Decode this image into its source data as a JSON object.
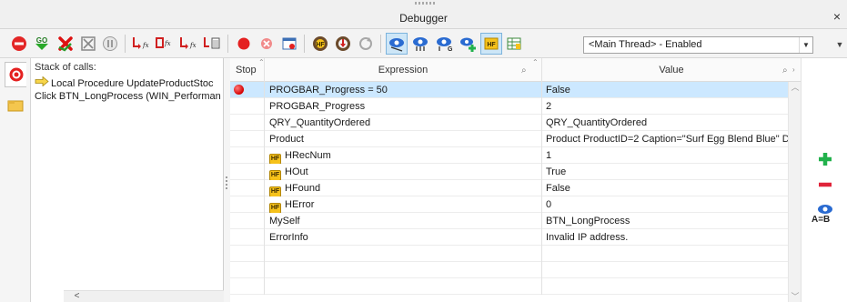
{
  "window": {
    "title": "Debugger",
    "close_glyph": "×"
  },
  "toolbar": {
    "icons": [
      "stop-circle-icon",
      "go-icon",
      "cancel-icon",
      "close-x-icon",
      "pause-icon",
      "step-into-icon",
      "step-over-icon",
      "step-out-icon",
      "run-to-cursor-icon",
      "breakpoint-icon",
      "clear-breakpoints-icon",
      "window-icon",
      "hf-trace-icon",
      "trace-icon",
      "refresh-icon",
      "watch-icon",
      "watch-all-icon",
      "watch-add-icon",
      "hf-toggle-icon",
      "table-toggle-icon"
    ],
    "thread": {
      "selected": "<Main Thread> - Enabled"
    }
  },
  "stack": {
    "title": "Stack of calls:",
    "rows": [
      "Local Procedure UpdateProductStoc",
      "Click BTN_LongProcess (WIN_Performan"
    ]
  },
  "grid": {
    "columns": {
      "stop": "Stop",
      "expression": "Expression",
      "value": "Value"
    },
    "rows": [
      {
        "stop": true,
        "hf": false,
        "expression": "PROGBAR_Progress = 50",
        "value": "False"
      },
      {
        "stop": false,
        "hf": false,
        "expression": "PROGBAR_Progress",
        "value": "2"
      },
      {
        "stop": false,
        "hf": false,
        "expression": "QRY_QuantityOrdered",
        "value": "QRY_QuantityOrdered"
      },
      {
        "stop": false,
        "hf": false,
        "expression": "Product",
        "value": "Product ProductID=2 Caption=\"Surf Egg Blend Blue\" Des"
      },
      {
        "stop": false,
        "hf": true,
        "expression": "HRecNum",
        "value": "1"
      },
      {
        "stop": false,
        "hf": true,
        "expression": "HOut",
        "value": "True"
      },
      {
        "stop": false,
        "hf": true,
        "expression": "HFound",
        "value": "False"
      },
      {
        "stop": false,
        "hf": true,
        "expression": "HError",
        "value": "0"
      },
      {
        "stop": false,
        "hf": false,
        "expression": "MySelf",
        "value": "BTN_LongProcess"
      },
      {
        "stop": false,
        "hf": false,
        "expression": "ErrorInfo",
        "value": "Invalid IP address."
      }
    ]
  },
  "right_panel": {
    "compare_label": "A=B"
  },
  "colors": {
    "selection": "#cce8ff",
    "accent": "#0078d7",
    "add": "#22b14c",
    "remove": "#e0243a"
  }
}
